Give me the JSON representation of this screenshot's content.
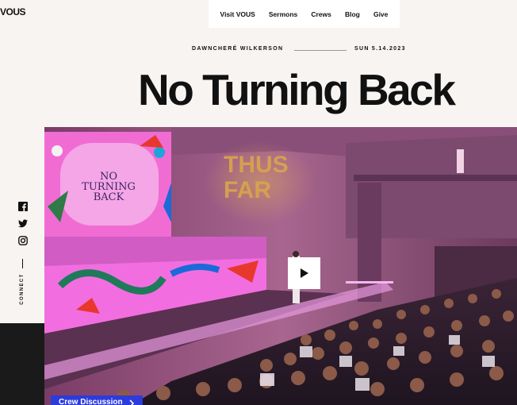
{
  "header": {
    "logo_text": "VOUS",
    "nav": [
      "Visit VOUS",
      "Sermons",
      "Crews",
      "Blog",
      "Give"
    ]
  },
  "sermon": {
    "author": "DAWNCHERÉ WILKERSON",
    "date": "SUN 5.14.2023",
    "title": "No Turning Back"
  },
  "video": {
    "screen_left_text": "NO TURNING BACK",
    "projection_text": "THUS FAR",
    "play_icon": "play-icon",
    "badge_label": "Crew Discussion",
    "badge_icon": "chevron-right-icon"
  },
  "sidebar": {
    "icons": [
      "facebook-icon",
      "twitter-icon",
      "instagram-icon"
    ],
    "connect_label": "CONNECT"
  },
  "colors": {
    "background": "#f7f4f2",
    "badge": "#2c3bdc",
    "stage_pink": "#e85ad9"
  }
}
